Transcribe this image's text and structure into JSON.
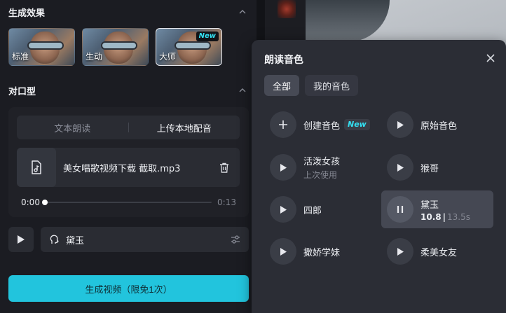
{
  "left": {
    "effects": {
      "title": "生成效果",
      "options": [
        {
          "label": "标准",
          "badge": ""
        },
        {
          "label": "生动",
          "badge": ""
        },
        {
          "label": "大师",
          "badge": "New"
        }
      ]
    },
    "lipsync": {
      "title": "对口型",
      "tabs": [
        "文本朗读",
        "上传本地配音"
      ],
      "file_name": "美女唱歌视频下载 截取.mp3",
      "time_current": "0:00",
      "time_total": "0:13",
      "progress": 0.0,
      "voice_name": "黛玉"
    },
    "generate_button": "生成视频（限免1次）"
  },
  "popup": {
    "title": "朗读音色",
    "filters": [
      "全部",
      "我的音色"
    ],
    "voices": [
      {
        "label": "创建音色",
        "badge": "New",
        "sub": ""
      },
      {
        "label": "原始音色",
        "sub": ""
      },
      {
        "label": "活泼女孩",
        "sub": "上次使用"
      },
      {
        "label": "猴哥",
        "sub": ""
      },
      {
        "label": "四郎",
        "sub": ""
      },
      {
        "label": "黛玉",
        "sub_current": "10.8",
        "sub_sep": "|",
        "sub_total": "13.5s"
      },
      {
        "label": "撒娇学妹",
        "sub": ""
      },
      {
        "label": "柔美女友",
        "sub": ""
      }
    ]
  },
  "colors": {
    "accent": "#22c4dd",
    "new_badge": "#33e0f2",
    "panel": "#2b2d35"
  }
}
